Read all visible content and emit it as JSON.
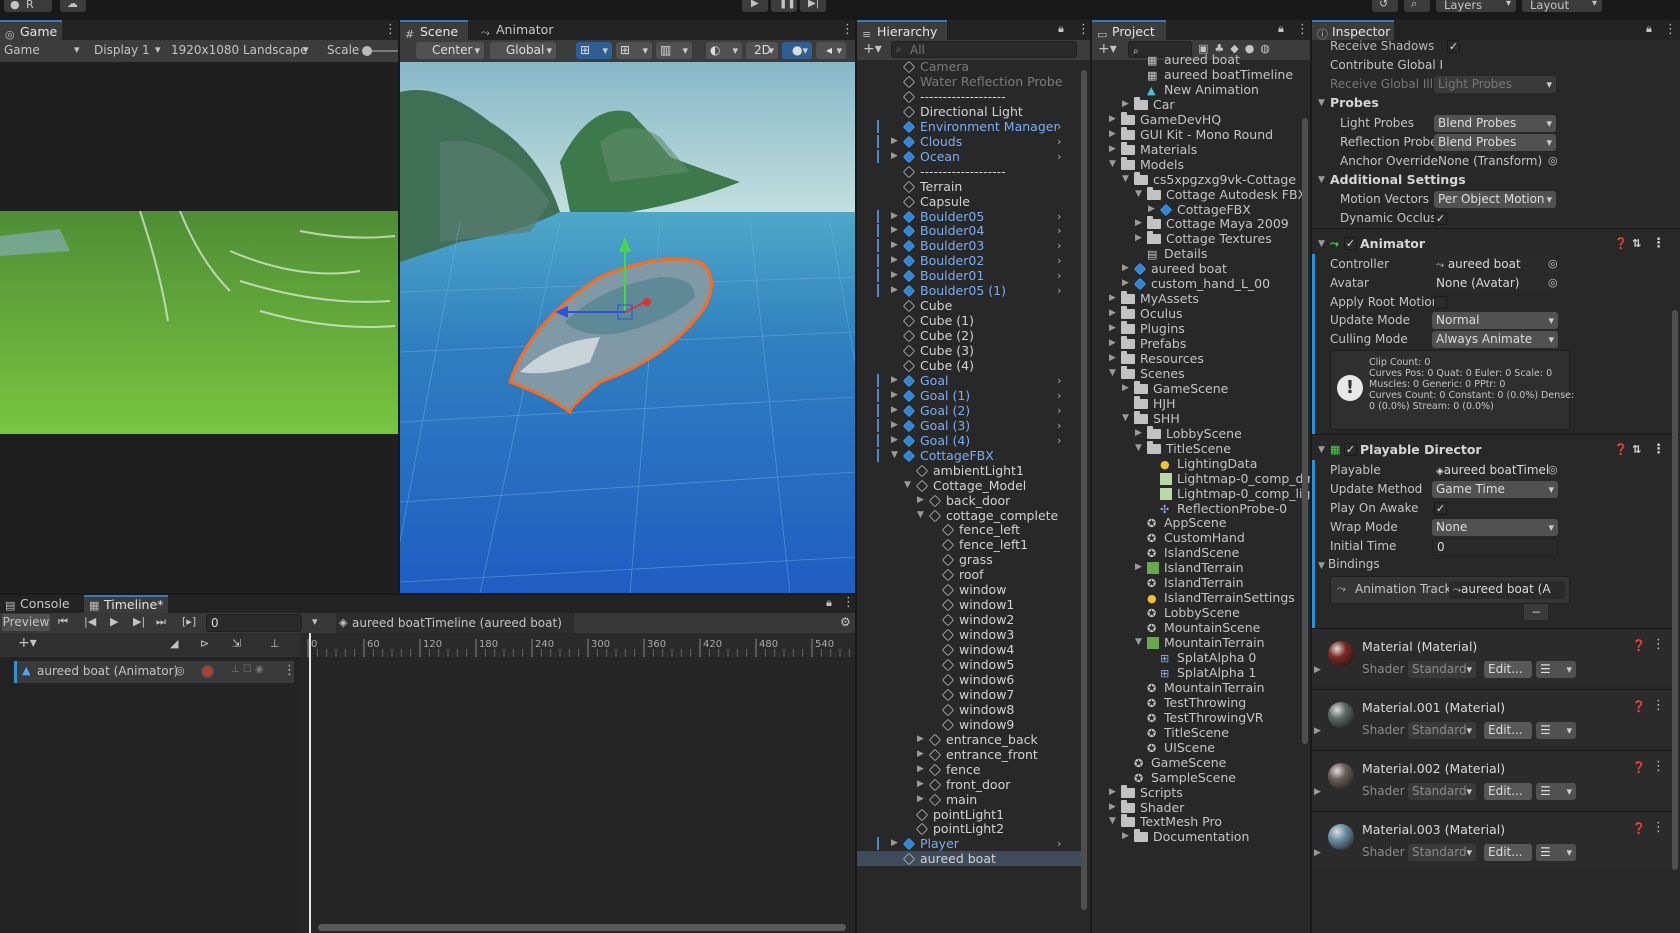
{
  "topbar": {
    "account": "R",
    "layers": "Layers",
    "layout": "Layout"
  },
  "game": {
    "tab": "Game",
    "mode": "Game",
    "display": "Display 1",
    "resolution": "1920x1080 Landscape",
    "scale": "Scale"
  },
  "scene": {
    "tab_scene": "Scene",
    "tab_animator": "Animator",
    "pivot": "Center",
    "space": "Global",
    "btn_2d": "2D"
  },
  "console": {
    "tab_console": "Console",
    "tab_timeline": "Timeline*",
    "preview": "Preview",
    "frame": "0",
    "asset": "aureed boatTimeline (aureed boat)",
    "track": "aureed boat (Animator)",
    "ruler": [
      "0",
      "60",
      "120",
      "180",
      "240",
      "300",
      "360",
      "420",
      "480",
      "540"
    ]
  },
  "hierarchy": {
    "tab": "Hierarchy",
    "search": "All",
    "items": [
      {
        "t": "Camera",
        "d": 0,
        "i": "cube",
        "dim": true
      },
      {
        "t": "Water Reflection Probe",
        "d": 0,
        "i": "cube",
        "dim": true
      },
      {
        "t": "-------------------",
        "d": 0,
        "i": "cube"
      },
      {
        "t": "Directional Light",
        "d": 0,
        "i": "cube"
      },
      {
        "t": "Environment Manager",
        "d": 0,
        "i": "blue",
        "chev": true
      },
      {
        "t": "Clouds",
        "d": 0,
        "i": "blue",
        "chev": true,
        "fold": true
      },
      {
        "t": "Ocean",
        "d": 0,
        "i": "blue",
        "chev": true,
        "fold": true
      },
      {
        "t": "-------------------",
        "d": 0,
        "i": "cube"
      },
      {
        "t": "Terrain",
        "d": 0,
        "i": "cube"
      },
      {
        "t": "Capsule",
        "d": 0,
        "i": "cube"
      },
      {
        "t": "Boulder05",
        "d": 0,
        "i": "blue",
        "chev": true,
        "fold": true
      },
      {
        "t": "Boulder04",
        "d": 0,
        "i": "blue",
        "chev": true,
        "fold": true
      },
      {
        "t": "Boulder03",
        "d": 0,
        "i": "blue",
        "chev": true,
        "fold": true
      },
      {
        "t": "Boulder02",
        "d": 0,
        "i": "blue",
        "chev": true,
        "fold": true
      },
      {
        "t": "Boulder01",
        "d": 0,
        "i": "blue",
        "chev": true,
        "fold": true
      },
      {
        "t": "Boulder05 (1)",
        "d": 0,
        "i": "blue",
        "chev": true,
        "fold": true
      },
      {
        "t": "Cube",
        "d": 0,
        "i": "cube"
      },
      {
        "t": "Cube (1)",
        "d": 0,
        "i": "cube"
      },
      {
        "t": "Cube (2)",
        "d": 0,
        "i": "cube"
      },
      {
        "t": "Cube (3)",
        "d": 0,
        "i": "cube"
      },
      {
        "t": "Cube (4)",
        "d": 0,
        "i": "cube"
      },
      {
        "t": "Goal",
        "d": 0,
        "i": "blue",
        "chev": true,
        "fold": true
      },
      {
        "t": "Goal (1)",
        "d": 0,
        "i": "blue",
        "chev": true,
        "fold": true
      },
      {
        "t": "Goal (2)",
        "d": 0,
        "i": "blue",
        "chev": true,
        "fold": true
      },
      {
        "t": "Goal (3)",
        "d": 0,
        "i": "blue",
        "chev": true,
        "fold": true
      },
      {
        "t": "Goal (4)",
        "d": 0,
        "i": "blue",
        "chev": true,
        "fold": true
      },
      {
        "t": "CottageFBX",
        "d": 0,
        "i": "blue",
        "open": true
      },
      {
        "t": "ambientLight1",
        "d": 1,
        "i": "cube"
      },
      {
        "t": "Cottage_Model",
        "d": 1,
        "i": "cube",
        "open": true
      },
      {
        "t": "back_door",
        "d": 2,
        "i": "cube",
        "fold": true
      },
      {
        "t": "cottage_complete",
        "d": 2,
        "i": "cube",
        "open": true
      },
      {
        "t": "fence_left",
        "d": 3,
        "i": "cube"
      },
      {
        "t": "fence_left1",
        "d": 3,
        "i": "cube"
      },
      {
        "t": "grass",
        "d": 3,
        "i": "cube"
      },
      {
        "t": "roof",
        "d": 3,
        "i": "cube"
      },
      {
        "t": "window",
        "d": 3,
        "i": "cube"
      },
      {
        "t": "window1",
        "d": 3,
        "i": "cube"
      },
      {
        "t": "window2",
        "d": 3,
        "i": "cube"
      },
      {
        "t": "window3",
        "d": 3,
        "i": "cube"
      },
      {
        "t": "window4",
        "d": 3,
        "i": "cube"
      },
      {
        "t": "window5",
        "d": 3,
        "i": "cube"
      },
      {
        "t": "window6",
        "d": 3,
        "i": "cube"
      },
      {
        "t": "window7",
        "d": 3,
        "i": "cube"
      },
      {
        "t": "window8",
        "d": 3,
        "i": "cube"
      },
      {
        "t": "window9",
        "d": 3,
        "i": "cube"
      },
      {
        "t": "entrance_back",
        "d": 2,
        "i": "cube",
        "fold": true
      },
      {
        "t": "entrance_front",
        "d": 2,
        "i": "cube",
        "fold": true
      },
      {
        "t": "fence",
        "d": 2,
        "i": "cube",
        "fold": true
      },
      {
        "t": "front_door",
        "d": 2,
        "i": "cube",
        "fold": true
      },
      {
        "t": "main",
        "d": 2,
        "i": "cube",
        "fold": true
      },
      {
        "t": "pointLight1",
        "d": 1,
        "i": "cube"
      },
      {
        "t": "pointLight2",
        "d": 1,
        "i": "cube"
      },
      {
        "t": "Player",
        "d": 0,
        "i": "blue",
        "chev": true,
        "fold": true
      },
      {
        "t": "aureed boat",
        "d": 0,
        "i": "cube",
        "sel": true
      }
    ]
  },
  "project": {
    "tab": "Project",
    "items": [
      {
        "t": "aureed boat",
        "d": 3,
        "i": "asset",
        "cut": true
      },
      {
        "t": "aureed boatTimeline",
        "d": 3,
        "i": "asset"
      },
      {
        "t": "New Animation",
        "d": 3,
        "i": "anim"
      },
      {
        "t": "Car",
        "d": 2,
        "i": "folder",
        "fold": true
      },
      {
        "t": "GameDevHQ",
        "d": 1,
        "i": "folder",
        "fold": true
      },
      {
        "t": "GUI Kit - Mono Round",
        "d": 1,
        "i": "folder",
        "fold": true
      },
      {
        "t": "Materials",
        "d": 1,
        "i": "folder",
        "fold": true
      },
      {
        "t": "Models",
        "d": 1,
        "i": "folder",
        "open": true
      },
      {
        "t": "cs5xpgzxg9vk-Cottage",
        "d": 2,
        "i": "folder",
        "open": true
      },
      {
        "t": "Cottage Autodesk FBX",
        "d": 3,
        "i": "folder",
        "open": true
      },
      {
        "t": "CottageFBX",
        "d": 4,
        "i": "prefab",
        "fold": true
      },
      {
        "t": "Cottage Maya 2009",
        "d": 3,
        "i": "folder",
        "fold": true
      },
      {
        "t": "Cottage Textures",
        "d": 3,
        "i": "folder",
        "fold": true
      },
      {
        "t": "Details",
        "d": 3,
        "i": "doc"
      },
      {
        "t": "aureed boat",
        "d": 2,
        "i": "prefab",
        "fold": true
      },
      {
        "t": "custom_hand_L_00",
        "d": 2,
        "i": "prefab",
        "fold": true
      },
      {
        "t": "MyAssets",
        "d": 1,
        "i": "folder",
        "fold": true
      },
      {
        "t": "Oculus",
        "d": 1,
        "i": "folder",
        "fold": true
      },
      {
        "t": "Plugins",
        "d": 1,
        "i": "folder",
        "fold": true
      },
      {
        "t": "Prefabs",
        "d": 1,
        "i": "folder",
        "fold": true
      },
      {
        "t": "Resources",
        "d": 1,
        "i": "folder",
        "fold": true
      },
      {
        "t": "Scenes",
        "d": 1,
        "i": "folder",
        "open": true
      },
      {
        "t": "GameScene",
        "d": 2,
        "i": "folder",
        "fold": true
      },
      {
        "t": "HJH",
        "d": 2,
        "i": "folder"
      },
      {
        "t": "SHH",
        "d": 2,
        "i": "folder",
        "open": true
      },
      {
        "t": "LobbyScene",
        "d": 3,
        "i": "folder",
        "fold": true
      },
      {
        "t": "TitleScene",
        "d": 3,
        "i": "folder",
        "open": true
      },
      {
        "t": "LightingData",
        "d": 4,
        "i": "light"
      },
      {
        "t": "Lightmap-0_comp_dir",
        "d": 4,
        "i": "tex"
      },
      {
        "t": "Lightmap-0_comp_light",
        "d": 4,
        "i": "tex"
      },
      {
        "t": "ReflectionProbe-0",
        "d": 4,
        "i": "probe"
      },
      {
        "t": "AppScene",
        "d": 3,
        "i": "unity"
      },
      {
        "t": "CustomHand",
        "d": 3,
        "i": "unity"
      },
      {
        "t": "IslandScene",
        "d": 3,
        "i": "unity"
      },
      {
        "t": "IslandTerrain",
        "d": 3,
        "i": "terrain",
        "fold": true
      },
      {
        "t": "IslandTerrain",
        "d": 3,
        "i": "unity"
      },
      {
        "t": "IslandTerrainSettings",
        "d": 3,
        "i": "light"
      },
      {
        "t": "LobbyScene",
        "d": 3,
        "i": "unity"
      },
      {
        "t": "MountainScene",
        "d": 3,
        "i": "unity"
      },
      {
        "t": "MountainTerrain",
        "d": 3,
        "i": "terrain",
        "open": true
      },
      {
        "t": "SplatAlpha 0",
        "d": 4,
        "i": "grid"
      },
      {
        "t": "SplatAlpha 1",
        "d": 4,
        "i": "grid"
      },
      {
        "t": "MountainTerrain",
        "d": 3,
        "i": "unity"
      },
      {
        "t": "TestThrowing",
        "d": 3,
        "i": "unity"
      },
      {
        "t": "TestThrowingVR",
        "d": 3,
        "i": "unity"
      },
      {
        "t": "TitleScene",
        "d": 3,
        "i": "unity"
      },
      {
        "t": "UIScene",
        "d": 3,
        "i": "unity"
      },
      {
        "t": "GameScene",
        "d": 2,
        "i": "unity"
      },
      {
        "t": "SampleScene",
        "d": 2,
        "i": "unity"
      },
      {
        "t": "Scripts",
        "d": 1,
        "i": "folder",
        "fold": true
      },
      {
        "t": "Shader",
        "d": 1,
        "i": "folder",
        "fold": true
      },
      {
        "t": "TextMesh Pro",
        "d": 1,
        "i": "folder",
        "open": true
      },
      {
        "t": "Documentation",
        "d": 2,
        "i": "folder",
        "fold": true
      }
    ]
  },
  "inspector": {
    "tab": "Inspector",
    "receive_shadows": "Receive Shadows",
    "contribute_gi": "Contribute Global I",
    "receive_gi": "Receive Global Illu",
    "receive_gi_val": "Light Probes",
    "probes": "Probes",
    "light_probes": "Light Probes",
    "light_probes_val": "Blend Probes",
    "reflection_probes": "Reflection Probes",
    "reflection_probes_val": "Blend Probes",
    "anchor": "Anchor Override",
    "anchor_val": "None (Transform)",
    "additional": "Additional Settings",
    "motion_vectors": "Motion Vectors",
    "motion_vectors_val": "Per Object Motion",
    "dynamic_occ": "Dynamic Occlusio",
    "animator": "Animator",
    "controller": "Controller",
    "controller_val": "aureed boat",
    "avatar": "Avatar",
    "avatar_val": "None (Avatar)",
    "apply_root": "Apply Root Motion",
    "update_mode": "Update Mode",
    "update_mode_val": "Normal",
    "culling": "Culling Mode",
    "culling_val": "Always Animate",
    "info1": "Clip Count: 0",
    "info2": "Curves Pos: 0 Quat: 0 Euler: 0 Scale: 0",
    "info3": "Muscles: 0 Generic: 0 PPtr: 0",
    "info4": "Curves Count: 0 Constant: 0 (0.0%) Dense:",
    "info5": "0 (0.0%) Stream: 0 (0.0%)",
    "director": "Playable Director",
    "playable": "Playable",
    "playable_val": "aureed boatTimel",
    "update_method": "Update Method",
    "update_method_val": "Game Time",
    "play_awake": "Play On Awake",
    "wrap": "Wrap Mode",
    "wrap_val": "None",
    "initial": "Initial Time",
    "initial_val": "0",
    "bindings": "Bindings",
    "anim_track": "Animation Track",
    "anim_track_val": "aureed boat (A",
    "minus": "−",
    "shader_lbl": "Shader",
    "shader_val": "Standard",
    "edit": "Edit...",
    "materials": [
      {
        "name": "Material (Material)",
        "color": "#7a2a22"
      },
      {
        "name": "Material.001 (Material)",
        "color": "#5e6a67"
      },
      {
        "name": "Material.002 (Material)",
        "color": "#6a5e5a"
      },
      {
        "name": "Material.003 (Material)",
        "color": "#6b8ea2"
      }
    ]
  }
}
